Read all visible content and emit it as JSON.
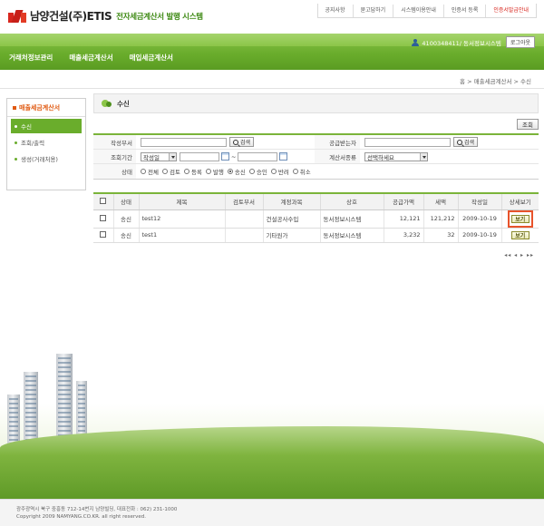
{
  "brand": {
    "name": "남양건설(주)",
    "product": "ETIS",
    "subtitle": "전자세금계산서 발행 시스템"
  },
  "top_links": [
    "공지사항",
    "묻고답하기",
    "시스템이용안내",
    "인증서 등록",
    "인증서발급안내"
  ],
  "user": {
    "info": "4100348411/ 동서정보시스템",
    "logout": "로그아웃"
  },
  "main_menu": [
    "거래처정보관리",
    "매출세금계산서",
    "매입세금계산서"
  ],
  "breadcrumb": "홈 > 매출세금계산서 > 수신",
  "sidebar": {
    "title": "매출세금계산서",
    "items": [
      "수신",
      "조회/출력",
      "생성(거래처용)"
    ]
  },
  "page": {
    "title": "수신",
    "search_button": "조회"
  },
  "search": {
    "writer_label": "작성부서",
    "search_label": "검색",
    "receiver_label": "공급받는자",
    "period_label": "조회기간",
    "period_type": "작성일",
    "tilde": "~",
    "kind_label": "계산서종류",
    "kind_value": "선택하세요",
    "status_label": "상태",
    "status_options": [
      "전체",
      "검토",
      "등록",
      "발행",
      "송신",
      "승인",
      "반려",
      "취소"
    ],
    "status_selected": "송신"
  },
  "table": {
    "headers": [
      "상태",
      "제목",
      "검토부서",
      "계정과목",
      "상호",
      "공급가액",
      "세액",
      "작성일",
      "상세보기"
    ],
    "rows": [
      {
        "status": "송신",
        "title": "test12",
        "dept": "",
        "account": "건설공사수입",
        "company": "동서정보시스템",
        "amount": "12,121",
        "tax": "121,212",
        "date": "2009-10-19",
        "detail": "보기"
      },
      {
        "status": "송신",
        "title": "test1",
        "dept": "",
        "account": "기타원가",
        "company": "동서정보시스템",
        "amount": "3,232",
        "tax": "32",
        "date": "2009-10-19",
        "detail": "보기"
      }
    ]
  },
  "pager": "◂◂ ◂ ▸ ▸▸",
  "footer": {
    "address": "광주광역시 북구 중흥동 712-14번지 남양빌딩, 대표전화 : 062) 231-1000",
    "copyright": "Copyright 2009 NAMYANG.CO.KR. all right reserved."
  },
  "colors": {
    "accent": "#6aad2c",
    "brand_red": "#d8261e",
    "highlight": "#e8532b"
  }
}
